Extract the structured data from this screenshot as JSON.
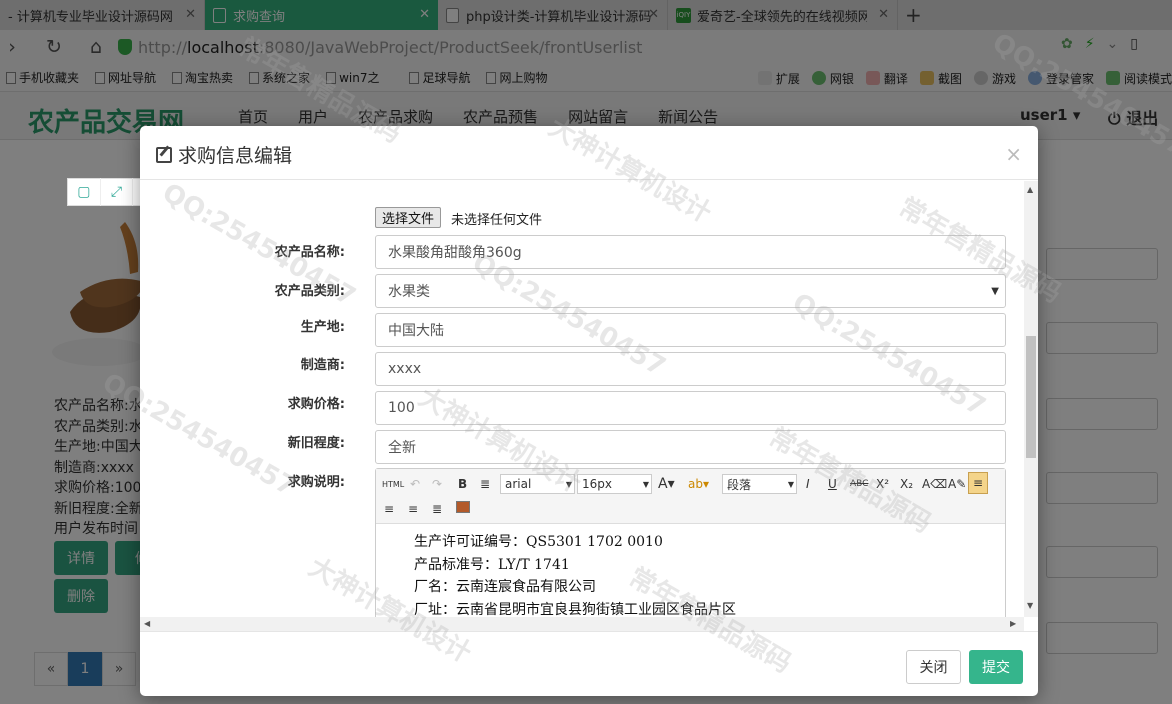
{
  "browser": {
    "tabs": [
      {
        "label": "- 计算机专业毕业设计源码网"
      },
      {
        "label": "求购查询"
      },
      {
        "label": "php设计类-计算机毕业设计源码"
      },
      {
        "label": "爱奇艺-全球领先的在线视频网站"
      }
    ],
    "url_prefix": "http://",
    "url_host": "localhost",
    "url_rest": ":8080/JavaWebProject/ProductSeek/frontUserlist",
    "bookmarks": [
      "手机收藏夹",
      "网址导航",
      "淘宝热卖",
      "系统之家",
      "win7之",
      "足球导航",
      "网上购物"
    ],
    "bookmark_tools": [
      "扩展",
      "网银",
      "翻译",
      "截图",
      "游戏",
      "登录管家",
      "阅读模式"
    ]
  },
  "site": {
    "logo": "农产品交易网",
    "nav": [
      "首页",
      "用户",
      "农产品求购",
      "农产品预售",
      "网站留言",
      "新闻公告"
    ],
    "user": "user1 ▾",
    "logout": "退出"
  },
  "product_card": {
    "lines": [
      "农产品名称:水",
      "农产品类别:水",
      "生产地:中国大",
      "制造商:xxxx",
      "求购价格:100",
      "新旧程度:全新",
      "用户发布时间"
    ],
    "detail_btn": "详情",
    "edit_btn": "修",
    "delete_btn": "删除"
  },
  "pager": {
    "prev": "«",
    "current": "1",
    "next": "»"
  },
  "modal": {
    "title": "求购信息编辑",
    "file_button": "选择文件",
    "file_status": "未选择任何文件",
    "fields": {
      "name_label": "农产品名称:",
      "name_value": "水果酸角甜酸角360g",
      "category_label": "农产品类别:",
      "category_value": "水果类",
      "origin_label": "生产地:",
      "origin_value": "中国大陆",
      "maker_label": "制造商:",
      "maker_value": "xxxx",
      "price_label": "求购价格:",
      "price_value": "100",
      "condition_label": "新旧程度:",
      "condition_value": "全新",
      "desc_label": "求购说明:"
    },
    "editor": {
      "font": "arial",
      "size": "16px",
      "block": "段落",
      "content": [
        "生产许可证编号：QS5301 1702 0010",
        "产品标准号：LY/T 1741",
        "厂名：云南连宸食品有限公司",
        "厂址：云南省昆明市宜良县狗街镇工业园区食品片区"
      ]
    },
    "close_button": "关闭",
    "submit_button": "提交"
  },
  "watermarks": [
    "大神计算机设计",
    "常年售精品源码",
    "QQ:254540457"
  ],
  "colors": {
    "accent": "#35b27e",
    "primary": "#337ab7"
  }
}
